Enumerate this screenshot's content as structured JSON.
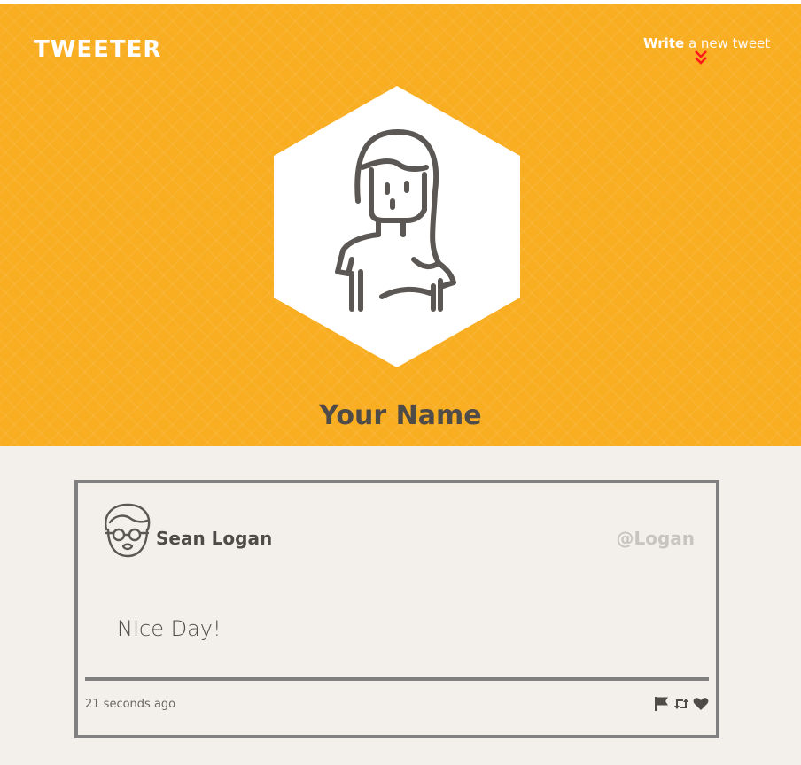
{
  "header": {
    "logo": "TWEETER",
    "compose": {
      "bold": "Write",
      "rest": " a new tweet"
    },
    "profile_name": "Your Name"
  },
  "tweet": {
    "author": "Sean Logan",
    "handle": "@Logan",
    "content": "NIce Day!",
    "time": "21 seconds ago"
  },
  "icons": {
    "compose_chevron": "double-chevron-down-icon",
    "profile_avatar": "woman-avatar-icon",
    "author_avatar": "man-with-glasses-avatar-icon",
    "actions": [
      "flag-icon",
      "retweet-icon",
      "heart-icon"
    ]
  },
  "colors": {
    "header_bg": "#f9ad20",
    "page_bg": "#f3f0ec",
    "text_dark": "#4e4b48",
    "handle": "#c7c4c1",
    "chevron": "#ff1a1a",
    "card_border": "#808080"
  }
}
